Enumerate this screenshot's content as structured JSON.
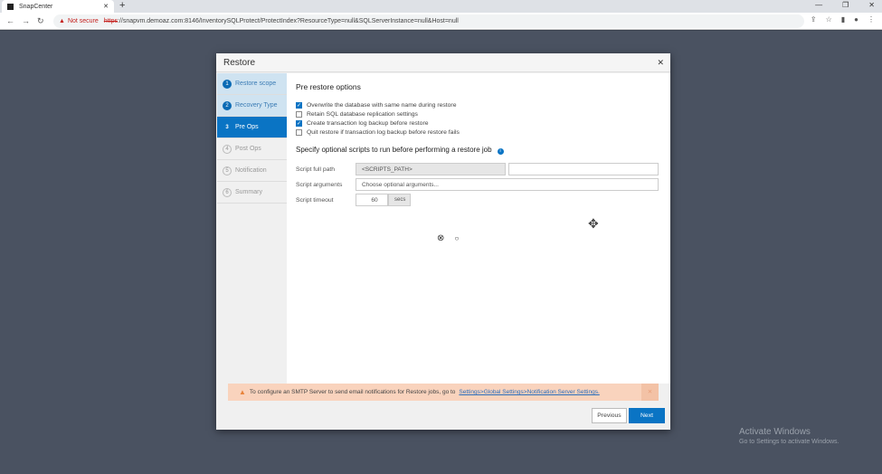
{
  "browser": {
    "tab_title": "SnapCenter",
    "not_secure": "Not secure",
    "url_scheme": "https",
    "url_rest": "://snapvm.demoaz.com:8146/InventorySQLProtect/ProtectIndex?ResourceType=null&SQLServerInstance=null&Host=null"
  },
  "dialog": {
    "title": "Restore",
    "steps": [
      {
        "num": "1",
        "label": "Restore scope"
      },
      {
        "num": "2",
        "label": "Recovery Type"
      },
      {
        "num": "3",
        "label": "Pre Ops"
      },
      {
        "num": "4",
        "label": "Post Ops"
      },
      {
        "num": "5",
        "label": "Notification"
      },
      {
        "num": "6",
        "label": "Summary"
      }
    ],
    "section_title": "Pre restore options",
    "options": [
      {
        "label": "Overwrite the database with same name during restore",
        "checked": true
      },
      {
        "label": "Retain SQL database replication settings",
        "checked": false
      },
      {
        "label": "Create transaction log backup before restore",
        "checked": true
      },
      {
        "label": "Quit restore if transaction log backup before restore fails",
        "checked": false
      }
    ],
    "scripts_title": "Specify optional scripts to run before performing a restore job",
    "script_path_label": "Script full path",
    "script_path_prefix": "<SCRIPTS_PATH>",
    "script_path_value": "",
    "script_args_label": "Script arguments",
    "script_args_placeholder": "Choose optional arguments...",
    "timeout_label": "Script timeout",
    "timeout_value": "60",
    "timeout_unit": "secs",
    "alert_text": "To configure an SMTP Server to send email notifications for Restore jobs, go to",
    "alert_link": "Settings>Global Settings>Notification Server Settings.",
    "previous": "Previous",
    "next": "Next"
  },
  "watermark": {
    "title": "Activate Windows",
    "subtitle": "Go to Settings to activate Windows."
  }
}
